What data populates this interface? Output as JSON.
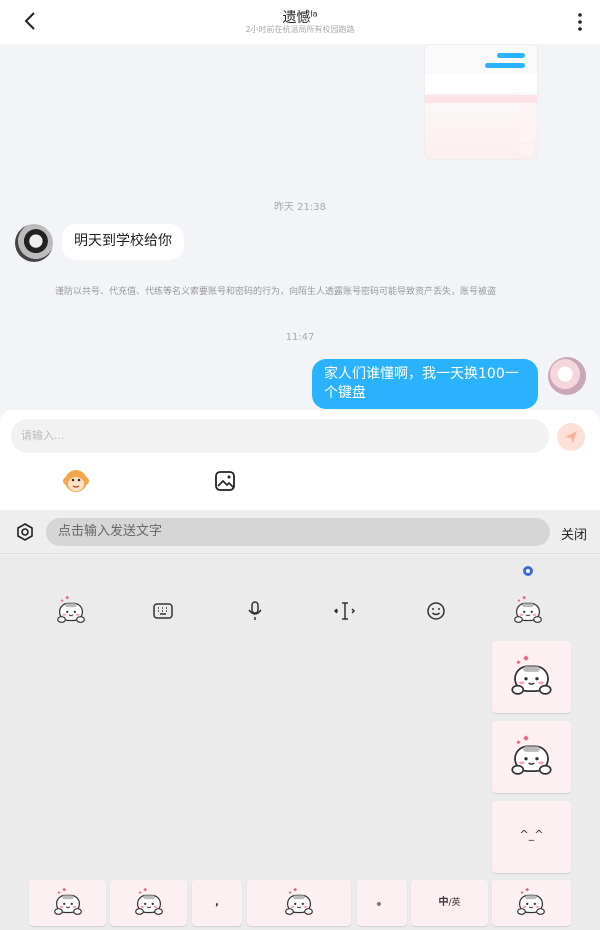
{
  "header": {
    "title": "遗憾",
    "title_badge": "la",
    "subtitle": "2小时前在杭温局所有校园跑路",
    "back_icon": "chevron-left-icon",
    "more_icon": "more-vertical-icon"
  },
  "messages": {
    "time_1": "昨天 21:38",
    "left_text": "明天到学校给你",
    "notice": "谨防以共号、代充值、代练等名义索要账号和密码的行为，向陌生人透露账号密码可能导致资产丢失，账号被盗",
    "time_2": "11:47",
    "right_text": "家人们谁懂啊，我一天换100一个键盘"
  },
  "composer": {
    "placeholder": "请输入...",
    "send_icon": "send-icon",
    "sticker_icon": "monkey-face-icon",
    "image_icon": "image-icon"
  },
  "ime": {
    "placeholder": "点击输入发送文字",
    "close_label": "关闭",
    "settings_icon": "hexagon-settings-icon"
  },
  "keyboard": {
    "tools": [
      "keyboard-icon",
      "microphone-icon",
      "cursor-icon",
      "smiley-icon"
    ],
    "face_key": "^_^",
    "comma_key": ",",
    "period_key": "。",
    "lang_key_main": "中",
    "lang_key_alt": "/英"
  },
  "colors": {
    "accent": "#2ab2ff",
    "key_bg": "#fdf0f2",
    "keyboard_bg": "#ebebeb"
  }
}
